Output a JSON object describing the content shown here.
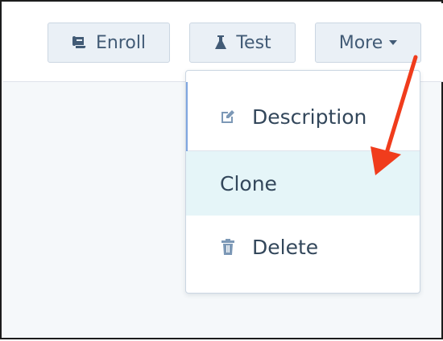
{
  "toolbar": {
    "enroll": {
      "label": "Enroll",
      "icon": "scroll-icon"
    },
    "test": {
      "label": "Test",
      "icon": "flask-icon"
    },
    "more": {
      "label": "More",
      "icon": "caret-down-icon"
    }
  },
  "menu": {
    "items": [
      {
        "label": "Description",
        "icon": "edit-icon"
      },
      {
        "label": "Clone",
        "highlighted": true
      },
      {
        "label": "Delete",
        "icon": "trash-icon"
      }
    ]
  },
  "colors": {
    "accent_arrow": "#f03c1c",
    "hover_bg": "#e5f5f8",
    "button_bg": "#eaf0f6",
    "text": "#33475b"
  }
}
